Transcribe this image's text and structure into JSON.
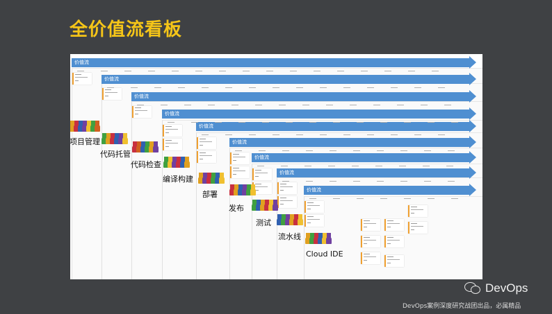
{
  "page": {
    "title": "全价值流看板",
    "brand": "DevOps",
    "subtitle": "DevOps案例深度研究战团出品，必属精品"
  },
  "board": {
    "arrow_label": "价值流",
    "stages": [
      {
        "label": "项目管理",
        "colors": [
          "#e0a020",
          "#c83040",
          "#3060b0",
          "#7040a0",
          "#f0c030",
          "#40a040",
          "#d06020"
        ]
      },
      {
        "label": "代码托管",
        "colors": [
          "#40a040",
          "#e0a020",
          "#c83040",
          "#3060b0",
          "#7040a0",
          "#f0c030"
        ]
      },
      {
        "label": "代码检查",
        "colors": [
          "#c83040",
          "#d06020",
          "#3060b0",
          "#40a040",
          "#e0a020",
          "#7040a0"
        ]
      },
      {
        "label": "编译构建",
        "colors": [
          "#40a040",
          "#f0c030",
          "#7040a0",
          "#c83040",
          "#3060b0",
          "#e0a020"
        ]
      },
      {
        "label": "部署",
        "colors": [
          "#e0a020",
          "#7040a0",
          "#c83040",
          "#40a040",
          "#3060b0",
          "#f0c030"
        ]
      },
      {
        "label": "发布",
        "colors": [
          "#c83040",
          "#e0a020",
          "#3060b0",
          "#7040a0",
          "#40a040",
          "#f0c030"
        ]
      },
      {
        "label": "测试",
        "colors": [
          "#40a040",
          "#3060b0",
          "#e0a020",
          "#c83040",
          "#f0c030",
          "#7040a0"
        ]
      },
      {
        "label": "流水线",
        "colors": [
          "#3060b0",
          "#40a040",
          "#7040a0",
          "#e0a020",
          "#c83040",
          "#f0c030"
        ]
      },
      {
        "label": "Cloud IDE",
        "colors": [
          "#e0a020",
          "#40a040",
          "#c83040",
          "#3060b0",
          "#f0c030",
          "#7040a0"
        ]
      }
    ]
  },
  "colors": {
    "background": "#3f4144",
    "title": "#f5c518",
    "arrow": "#4f8fd1",
    "card_accent": "#f0a030"
  }
}
